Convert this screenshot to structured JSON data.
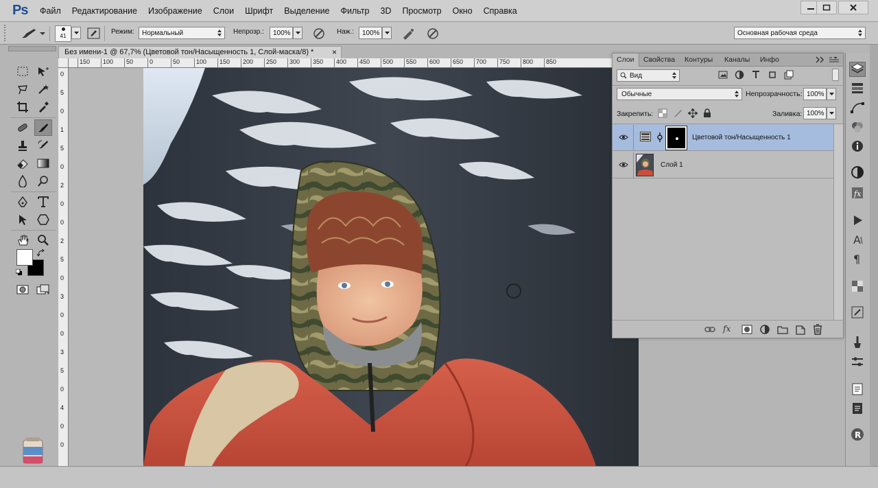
{
  "app": {
    "logo": "Ps",
    "menu": [
      "Файл",
      "Редактирование",
      "Изображение",
      "Слои",
      "Шрифт",
      "Выделение",
      "Фильтр",
      "3D",
      "Просмотр",
      "Окно",
      "Справка"
    ]
  },
  "options_bar": {
    "brush_size": "41",
    "mode_label": "Режим:",
    "mode_value": "Нормальный",
    "opacity_label": "Непрозр.:",
    "opacity_value": "100%",
    "flow_label": "Наж.:",
    "flow_value": "100%",
    "workspace_value": "Основная рабочая среда"
  },
  "document": {
    "tab_title": "Без имени-1 @ 67,7% (Цветовой тон/Насыщенность 1, Слой-маска/8) *",
    "close_glyph": "×"
  },
  "ruler": {
    "top_labels": [
      "150",
      "100",
      "50",
      "0",
      "50",
      "100",
      "150",
      "200",
      "250",
      "300",
      "350",
      "400",
      "450",
      "500",
      "550",
      "600",
      "650",
      "700",
      "750",
      "800",
      "850"
    ],
    "left_labels": [
      "0",
      "5",
      "0",
      "1",
      "5",
      "0",
      "2",
      "0",
      "0",
      "2",
      "5",
      "0",
      "3",
      "0",
      "0",
      "3",
      "5",
      "0",
      "4",
      "0",
      "0"
    ]
  },
  "layers_panel": {
    "tabs": [
      "Слои",
      "Свойства",
      "Контуры",
      "Каналы",
      "Инфо"
    ],
    "filter_value": "Вид",
    "blend_mode": "Обычные",
    "opacity_label": "Непрозрачность:",
    "opacity_value": "100%",
    "lock_label": "Закрепить:",
    "fill_label": "Заливка:",
    "fill_value": "100%",
    "layers": [
      {
        "name": "Цветовой тон/Насыщенность 1",
        "selected": true,
        "visible": true
      },
      {
        "name": "Слой 1",
        "selected": false,
        "visible": true
      }
    ]
  },
  "colors": {
    "foreground": "#ffffff",
    "background": "#000000",
    "selection": "#a6bcde",
    "brand": "#1f4f93"
  },
  "icons": {
    "right_dock": [
      "layers-icon",
      "adjustments-icon",
      "paths-icon",
      "color-icon",
      "info-icon",
      "histogram-icon",
      "styles-icon",
      "actions-icon",
      "character-icon",
      "paragraph-icon",
      "swatches-icon",
      "navigator-icon",
      "brush-icon",
      "tool-presets-icon",
      "notes-icon",
      "clipboard-icon",
      "r-logo-icon"
    ]
  }
}
